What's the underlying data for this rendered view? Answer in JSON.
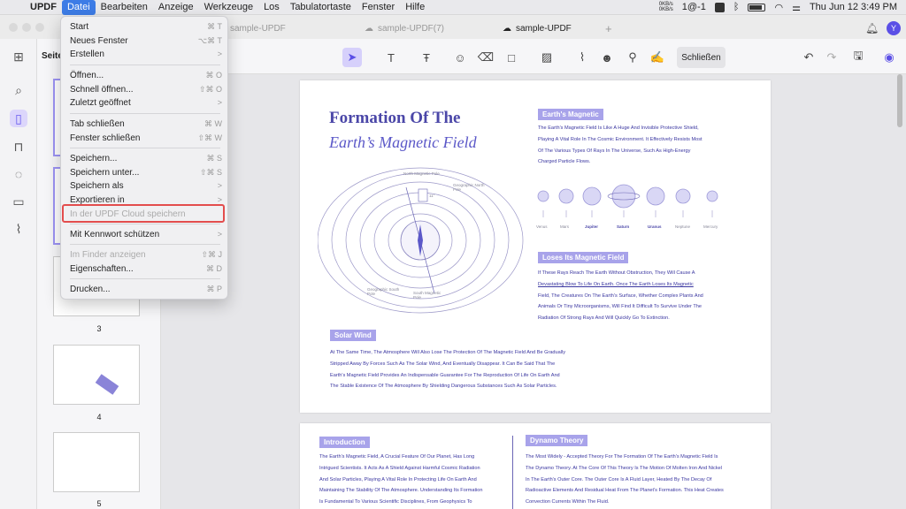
{
  "menubar": {
    "app": "UPDF",
    "items": [
      "Datei",
      "Bearbeiten",
      "Anzeige",
      "Werkzeuge",
      "Los",
      "Tabulatortaste",
      "Fenster",
      "Hilfe"
    ],
    "net_up": "0KB/s",
    "net_down": "0KB/s",
    "status_text": "1@-1",
    "clock": "Thu Jun 12  3:49 PM"
  },
  "tabs": [
    {
      "label": "sample-UPDF"
    },
    {
      "label": "sample-UPDF(7)"
    },
    {
      "label": "sample-UPDF"
    }
  ],
  "user_initial": "Y",
  "thumbs": {
    "header": "Seiten",
    "numbers": [
      "3",
      "4",
      "5"
    ]
  },
  "toolbar": {
    "close_label": "Schließen"
  },
  "menu": {
    "items": [
      {
        "label": "Start",
        "shortcut": "⌘ T"
      },
      {
        "label": "Neues Fenster",
        "shortcut": "⌥⌘ T"
      },
      {
        "label": "Erstellen",
        "shortcut": ">"
      },
      {
        "label": "Öffnen...",
        "shortcut": "⌘ O"
      },
      {
        "label": "Schnell öffnen...",
        "shortcut": "⇧⌘ O"
      },
      {
        "label": "Zuletzt geöffnet",
        "shortcut": ">"
      },
      {
        "label": "Tab schließen",
        "shortcut": "⌘ W"
      },
      {
        "label": "Fenster schließen",
        "shortcut": "⇧⌘ W"
      },
      {
        "label": "Speichern...",
        "shortcut": "⌘ S"
      },
      {
        "label": "Speichern unter...",
        "shortcut": "⇧⌘ S"
      },
      {
        "label": "Speichern als",
        "shortcut": ">"
      },
      {
        "label": "Exportieren in",
        "shortcut": ">"
      },
      {
        "label": "In der UPDF Cloud speichern",
        "shortcut": ""
      },
      {
        "label": "Mit Kennwort schützen",
        "shortcut": ">"
      },
      {
        "label": "Im Finder anzeigen",
        "shortcut": "⇧⌘ J"
      },
      {
        "label": "Eigenschaften...",
        "shortcut": "⌘ D"
      },
      {
        "label": "Drucken...",
        "shortcut": "⌘ P"
      }
    ]
  },
  "doc": {
    "title1": "Formation Of The",
    "title2": "Earth’s Magnetic Field",
    "badge_magnetic": "Earth's Magnetic",
    "para_magnetic": [
      "The Earth's Magnetic Field Is Like A Huge And Invisible Protective Shield,",
      "Playing A Vital Role In The Cosmic Environment. It Effectively Resists Most",
      "Of The Various Types Of Rays In The Universe, Such As High-Energy",
      "Charged Particle Flows."
    ],
    "planets": [
      "Venus",
      "Mars",
      "Jupiter",
      "Saturn",
      "Uranus",
      "Neptune",
      "Mercury"
    ],
    "badge_loses": "Loses Its Magnetic Field",
    "para_loses": [
      "If These Rays Reach The Earth Without Obstruction, They Will Cause A",
      "Devastating Blow To Life On Earth. Once The Earth Loses Its Magnetic",
      "Field, The Creatures On The Earth's Surface, Whether Complex Plants And",
      "Animals Or Tiny Microorganisms, Will Find It Difficult To Survive Under The",
      "Radiation Of Strong Rays And Will Quickly Go To Extinction."
    ],
    "badge_solar": "Solar Wind",
    "para_solar": [
      "At The Same Time, The Atmosphere Will Also Lose The Protection Of The Magnetic Field And Be Gradually",
      "Stripped Away By Forces Such As The Solar Wind, And Eventually Disappear. It Can Be Said That The",
      "Earth's Magnetic Field Provides An Indispensable Guarantee For The Reproduction Of Life On Earth And",
      "The Stable Existence Of The Atmosphere By Shielding Dangerous Substances Such As Solar Particles."
    ],
    "diagram_labels": {
      "north_mag": "North Magnetic Pole",
      "geo_north": "Geographic North Pole",
      "geo_south": "Geographic South Pole",
      "south_mag": "South Magnetic Pole",
      "angle": "11°"
    },
    "badge_intro": "Introduction",
    "para_intro": [
      "The Earth's Magnetic Field, A Crucial Feature Of Our Planet, Has Long",
      "Intrigued Scientists. It Acts As A Shield Against Harmful Cosmic Radiation",
      "And Solar Particles, Playing A Vital Role In Protecting Life On Earth And",
      "Maintaining The Stability Of The Atmosphere. Understanding Its Formation",
      "Is Fundamental To Various Scientific Disciplines, From Geophysics To"
    ],
    "badge_dynamo": "Dynamo Theory",
    "para_dynamo": [
      "The Most Widely - Accepted Theory For The Formation Of The Earth's Magnetic Field Is",
      "The Dynamo Theory. At The Core Of This Theory Is The Motion Of Molten Iron And Nickel",
      "In The Earth's Outer Core. The Outer Core Is A Fluid Layer, Heated By The Decay Of",
      "Radioactive Elements And Residual Heat From The Planet's Formation. This Heat Creates",
      "Convection Currents Within The Fluid."
    ]
  }
}
